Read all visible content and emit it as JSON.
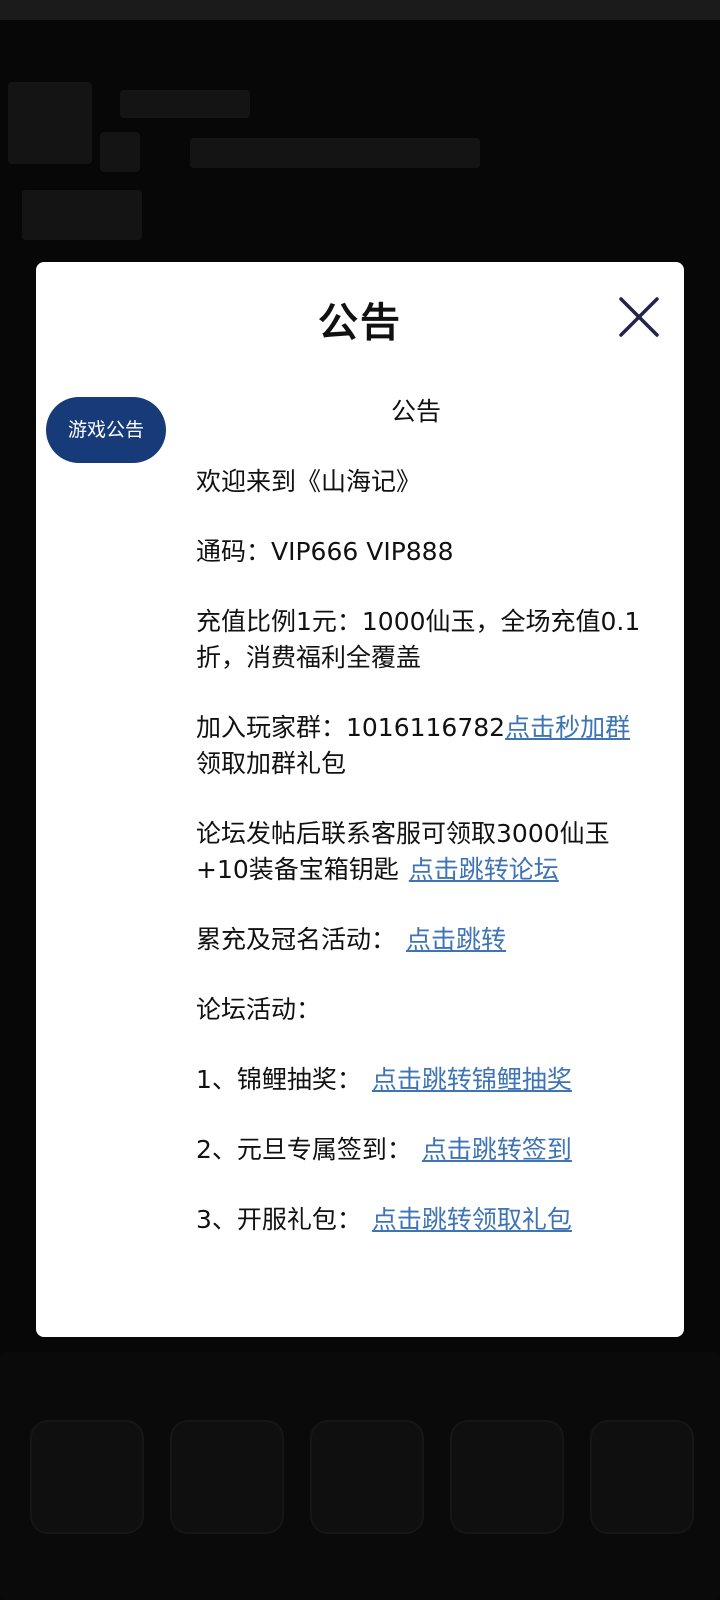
{
  "dialog": {
    "title": "公告",
    "close_icon": "close-icon",
    "tab_label": "游戏公告",
    "tab_color": "#173a78",
    "link_color": "#3e74b4"
  },
  "notice": {
    "heading": "公告",
    "welcome": "欢迎来到《山海记》",
    "codes": "通码：VIP666 VIP888",
    "recharge": "充值比例1元：1000仙玉，全场充值0.1折，消费福利全覆盖",
    "group_prefix": "加入玩家群：1016116782",
    "group_link": "点击秒加群",
    "group_suffix": "领取加群礼包",
    "forum_text": "论坛发帖后联系客服可领取3000仙玉+10装备宝箱钥匙",
    "forum_link": "点击跳转论坛",
    "activity_label": "累充及冠名活动：",
    "activity_link": "点击跳转",
    "forum_activities_label": "论坛活动：",
    "item1_label": "1、锦鲤抽奖：",
    "item1_link": "点击跳转锦鲤抽奖",
    "item2_label": "2、元旦专属签到：",
    "item2_link": "点击跳转签到",
    "item3_label": "3、开服礼包：",
    "item3_link": "点击跳转领取礼包"
  }
}
